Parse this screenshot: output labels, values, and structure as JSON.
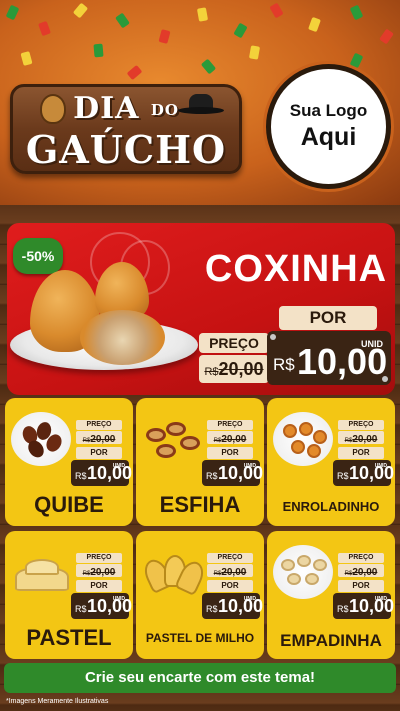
{
  "header": {
    "title_line1_a": "DIA",
    "title_line1_b": "DO",
    "title_line2": "GAÚCHO",
    "logo_line1": "Sua Logo",
    "logo_line2": "Aqui"
  },
  "featured": {
    "discount": "-50%",
    "name": "COXINHA",
    "preco_label": "PREÇO",
    "old_currency": "R$",
    "old_price": "20,00",
    "por_label": "POR",
    "new_currency": "R$",
    "new_price": "10,00",
    "unit": "UNID"
  },
  "products": [
    {
      "name": "QUIBE",
      "preco_label": "PREÇO",
      "old_currency": "R$",
      "old_price": "20,00",
      "por_label": "POR",
      "new_currency": "R$",
      "new_price": "10,00",
      "unit": "UNID"
    },
    {
      "name": "ESFIHA",
      "preco_label": "PREÇO",
      "old_currency": "R$",
      "old_price": "20,00",
      "por_label": "POR",
      "new_currency": "R$",
      "new_price": "10,00",
      "unit": "UNID"
    },
    {
      "name": "ENROLADINHO",
      "preco_label": "PREÇO",
      "old_currency": "R$",
      "old_price": "20,00",
      "por_label": "POR",
      "new_currency": "R$",
      "new_price": "10,00",
      "unit": "UNID"
    },
    {
      "name": "PASTEL",
      "preco_label": "PREÇO",
      "old_currency": "R$",
      "old_price": "20,00",
      "por_label": "POR",
      "new_currency": "R$",
      "new_price": "10,00",
      "unit": "UNID"
    },
    {
      "name": "PASTEL DE MILHO",
      "preco_label": "PREÇO",
      "old_currency": "R$",
      "old_price": "20,00",
      "por_label": "POR",
      "new_currency": "R$",
      "new_price": "10,00",
      "unit": "UNID"
    },
    {
      "name": "EMPADINHA",
      "preco_label": "PREÇO",
      "old_currency": "R$",
      "old_price": "20,00",
      "por_label": "POR",
      "new_currency": "R$",
      "new_price": "10,00",
      "unit": "UNID"
    }
  ],
  "cta": {
    "label": "Crie seu encarte com este tema!"
  },
  "footnote": "*Imagens Meramente Ilustrativas",
  "colors": {
    "red_panel": "#c61212",
    "card_yellow": "#f3c614",
    "green_cta": "#2f8a2a",
    "price_dark": "#3a2414",
    "tag_cream": "#f3e2c7"
  }
}
